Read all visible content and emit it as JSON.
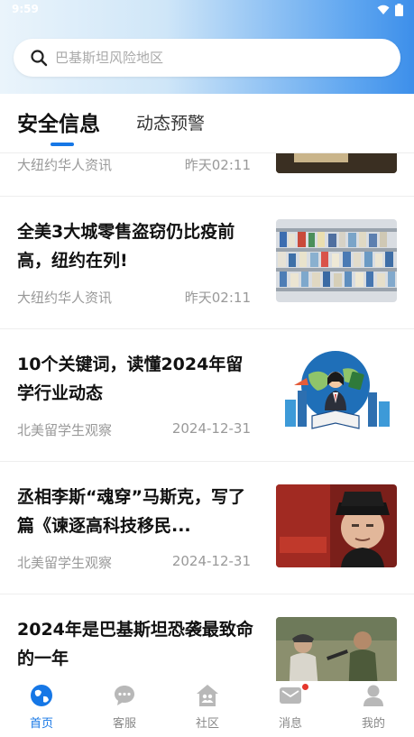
{
  "status": {
    "time": "9:59"
  },
  "search": {
    "placeholder": "巴基斯坦风险地区"
  },
  "tabs": [
    {
      "label": "安全信息",
      "active": true
    },
    {
      "label": "动态预警",
      "active": false
    }
  ],
  "feed": {
    "items": [
      {
        "title": "",
        "source": "大纽约华人资讯",
        "time": "昨天02:11"
      },
      {
        "title": "全美3大城零售盗窃仍比疫前高，纽约在列!",
        "source": "大纽约华人资讯",
        "time": "昨天02:11"
      },
      {
        "title": "10个关键词，读懂2024年留学行业动态",
        "source": "北美留学生观察",
        "time": "2024-12-31"
      },
      {
        "title": "丞相李斯“魂穿”马斯克，写了篇《谏逐高科技移民...",
        "source": "北美留学生观察",
        "time": "2024-12-31"
      },
      {
        "title": "2024年是巴基斯坦恐袭最致命的一年",
        "source": "",
        "time": ""
      }
    ]
  },
  "bottom_nav": [
    {
      "label": "首页",
      "icon": "globe-icon",
      "active": true
    },
    {
      "label": "客服",
      "icon": "chat-bubble-icon",
      "active": false
    },
    {
      "label": "社区",
      "icon": "community-house-icon",
      "active": false
    },
    {
      "label": "消息",
      "icon": "mail-icon",
      "active": false,
      "badge": true
    },
    {
      "label": "我的",
      "icon": "person-icon",
      "active": false
    }
  ],
  "colors": {
    "accent": "#1677e6",
    "badge": "#e5362c"
  }
}
